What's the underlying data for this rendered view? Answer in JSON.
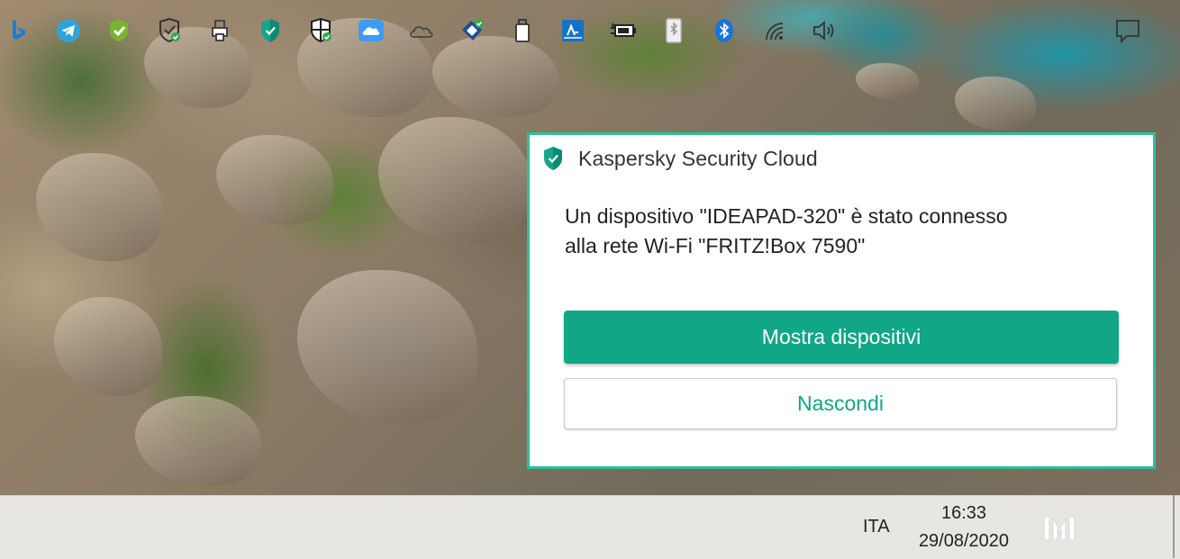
{
  "notification": {
    "app_name": "Kaspersky Security Cloud",
    "message_line1": "Un dispositivo \"IDEAPAD-320\" è stato connesso",
    "message_line2": "alla rete Wi-Fi \"FRITZ!Box 7590\"",
    "primary_button": "Mostra dispositivi",
    "secondary_button": "Nascondi",
    "accent_color": "#10a686",
    "border_color": "#2fbf9d"
  },
  "taskbar": {
    "tray_icons": [
      "bing-icon",
      "telegram-icon",
      "green-shield-app-icon",
      "shield-check-icon",
      "printer-icon",
      "kaspersky-icon",
      "windows-security-icon",
      "icloud-icon",
      "onedrive-icon",
      "network-sync-icon",
      "usb-drive-icon",
      "hp-support-icon",
      "battery-charging-icon",
      "bluetooth-file-icon",
      "bluetooth-icon",
      "wifi-icon",
      "volume-icon",
      "notification-center-icon"
    ],
    "language": "ITA",
    "time": "16:33",
    "date": "29/08/2020"
  }
}
